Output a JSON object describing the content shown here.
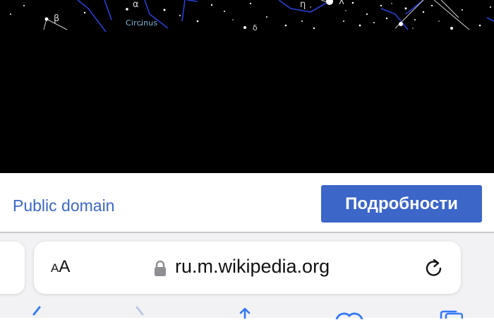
{
  "image": {
    "constellation_label": "Circinus",
    "star_labels": [
      "β",
      "α",
      "η",
      "λ",
      "δ"
    ]
  },
  "caption": {
    "license_label": "Public domain",
    "details_button_label": "Подробности"
  },
  "browser": {
    "text_size_label_small": "A",
    "text_size_label_large": "A",
    "url": "ru.m.wikipedia.org",
    "icons": {
      "lock": "lock-icon",
      "reload": "reload-icon",
      "back": "chevron-left-icon",
      "forward": "chevron-right-icon",
      "share": "share-icon",
      "bookmarks": "book-icon",
      "tabs": "tabs-icon"
    }
  },
  "colors": {
    "link": "#3d67c6",
    "button": "#3c66c8",
    "toolbar_icons": "#3478f6"
  }
}
